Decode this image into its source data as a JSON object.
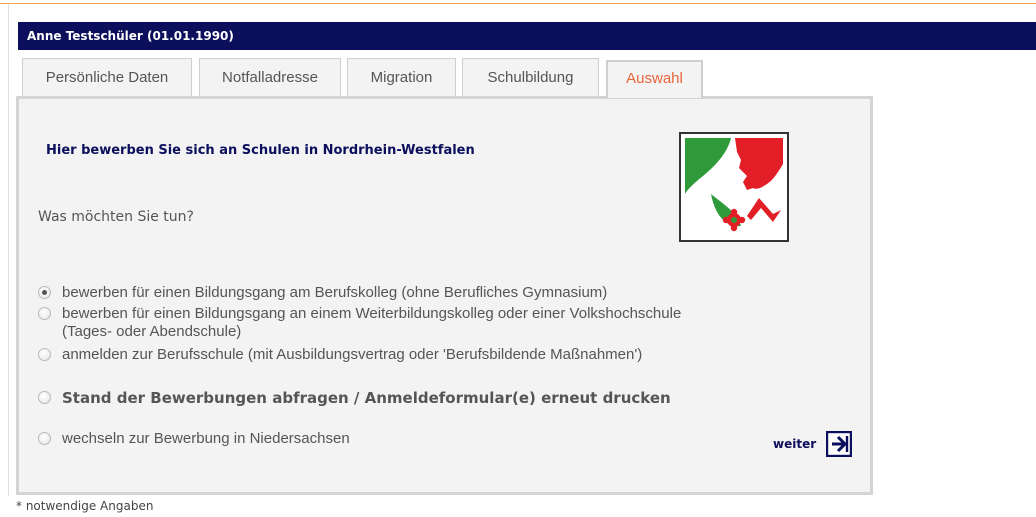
{
  "header": {
    "title": "Anne Testschüler (01.01.1990)"
  },
  "tabs": [
    {
      "label": "Persönliche Daten"
    },
    {
      "label": "Notfalladresse"
    },
    {
      "label": "Migration"
    },
    {
      "label": "Schulbildung"
    },
    {
      "label": "Auswahl",
      "active": true
    }
  ],
  "main": {
    "headline": "Hier bewerben Sie sich an Schulen in Nordrhein-Westfalen",
    "question": "Was möchten Sie tun?",
    "options": [
      {
        "line1": "bewerben für einen Bildungsgang am Berufskolleg (ohne Berufliches Gymnasium)",
        "checked": true
      },
      {
        "line1": "bewerben für einen Bildungsgang an einem Weiterbildungskolleg oder einer Volkshochschule",
        "line2": "(Tages- oder Abendschule)",
        "checked": false
      },
      {
        "line1": "anmelden zur Berufsschule (mit Ausbildungsvertrag oder 'Berufsbildende Maßnahmen')",
        "checked": false
      },
      {
        "line1": "Stand der Bewerbungen abfragen / Anmeldeformular(e) erneut drucken",
        "checked": false,
        "bold": true
      },
      {
        "line1": "wechseln zur Bewerbung in Niedersachsen",
        "checked": false
      }
    ],
    "next_label": "weiter",
    "crest_icon": "nrw-coat-of-arms"
  },
  "footer": {
    "note": "* notwendige Angaben"
  },
  "colors": {
    "header_bg": "#0b0f5c",
    "active_tab_text": "#e8663c",
    "panel_bg": "#f3f3f3"
  }
}
